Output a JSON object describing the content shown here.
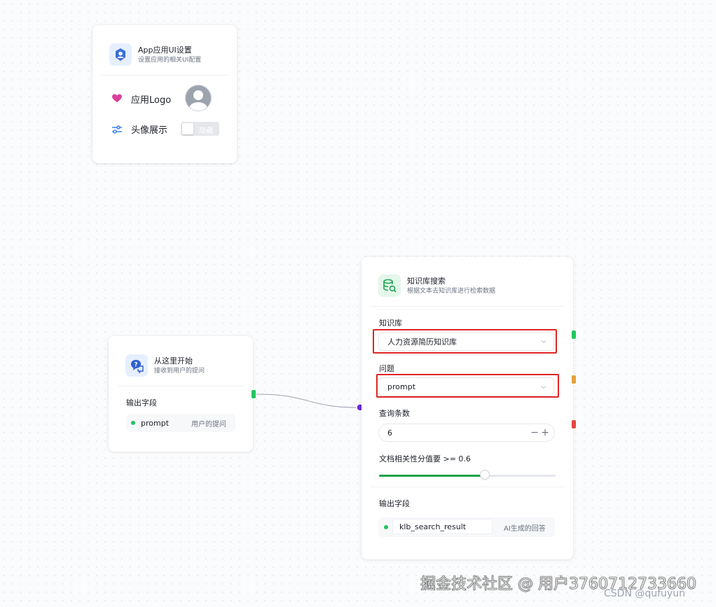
{
  "app_card": {
    "title": "App应用UI设置",
    "desc": "设置应用的相关UI配置",
    "logo_label": "应用Logo",
    "avatar_label": "头像展示",
    "avatar_toggle_text": "隐藏"
  },
  "start_card": {
    "title": "从这里开始",
    "desc": "接收到用户的提问",
    "output_label": "输出字段",
    "field_name": "prompt",
    "field_desc": "用户的提问"
  },
  "kb_card": {
    "title": "知识库搜索",
    "desc": "根据文本去知识库进行检索数据",
    "kb_label": "知识库",
    "kb_value": "人力资源简历知识库",
    "question_label": "问题",
    "question_value": "prompt",
    "count_label": "查询条数",
    "count_value": "6",
    "relevance_label": "文档相关性分值要 >= 0.6",
    "relevance_value": 0.6,
    "output_label": "输出字段",
    "output_field": "klb_search_result",
    "output_desc": "AI生成的回答"
  },
  "handles": {
    "start_output": "#22c55e",
    "kb_input": "#6d28d9",
    "kb_knowledge": "#22c55e",
    "kb_question": "#e3a33a",
    "kb_count": "#e0493d"
  },
  "watermark": {
    "main": "掘金技术社区 @ 用户3760712733660",
    "csdn": "CSDN @qufuyun"
  }
}
